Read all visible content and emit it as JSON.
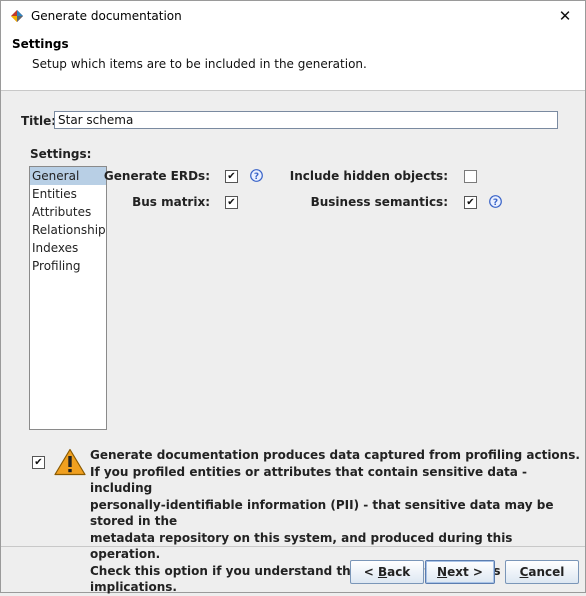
{
  "window": {
    "title": "Generate documentation",
    "close_glyph": "✕"
  },
  "header": {
    "title": "Settings",
    "description": "Setup which items are to be included in the generation."
  },
  "form": {
    "title_label": "Title:",
    "title_value": "Star schema",
    "settings_label": "Settings:",
    "settings_items": [
      "General",
      "Entities",
      "Attributes",
      "Relationships",
      "Indexes",
      "Profiling"
    ],
    "selected_item": "General"
  },
  "options": {
    "generate_erds": {
      "label": "Generate ERDs:",
      "checked": true
    },
    "bus_matrix": {
      "label": "Bus matrix:",
      "checked": true
    },
    "include_hidden_objects": {
      "label": "Include hidden objects:",
      "checked": false
    },
    "business_semantics": {
      "label": "Business semantics:",
      "checked": true
    }
  },
  "warning": {
    "checked": true,
    "lines": [
      "Generate documentation produces data captured from profiling actions.",
      "If you profiled entities or attributes that contain sensitive data - including",
      "personally-identifiable information (PII) - that sensitive data may be stored in the",
      "metadata repository on this system, and produced during this operation.",
      "Check this option if you understand this information, and its implications."
    ]
  },
  "buttons": {
    "back": {
      "prefix": "< ",
      "mnemonic": "B",
      "rest": "ack"
    },
    "next": {
      "mnemonic": "N",
      "rest": "ext >"
    },
    "cancel": {
      "mnemonic": "C",
      "rest": "ancel"
    }
  },
  "icons": {
    "app": "app-logo-icon",
    "help": "question-mark-icon",
    "warning": "warning-triangle-icon",
    "close": "close-icon"
  },
  "colors": {
    "selection": "#b8cfe5",
    "help_blue": "#3a64c8",
    "warning_orange": "#f0a020"
  }
}
